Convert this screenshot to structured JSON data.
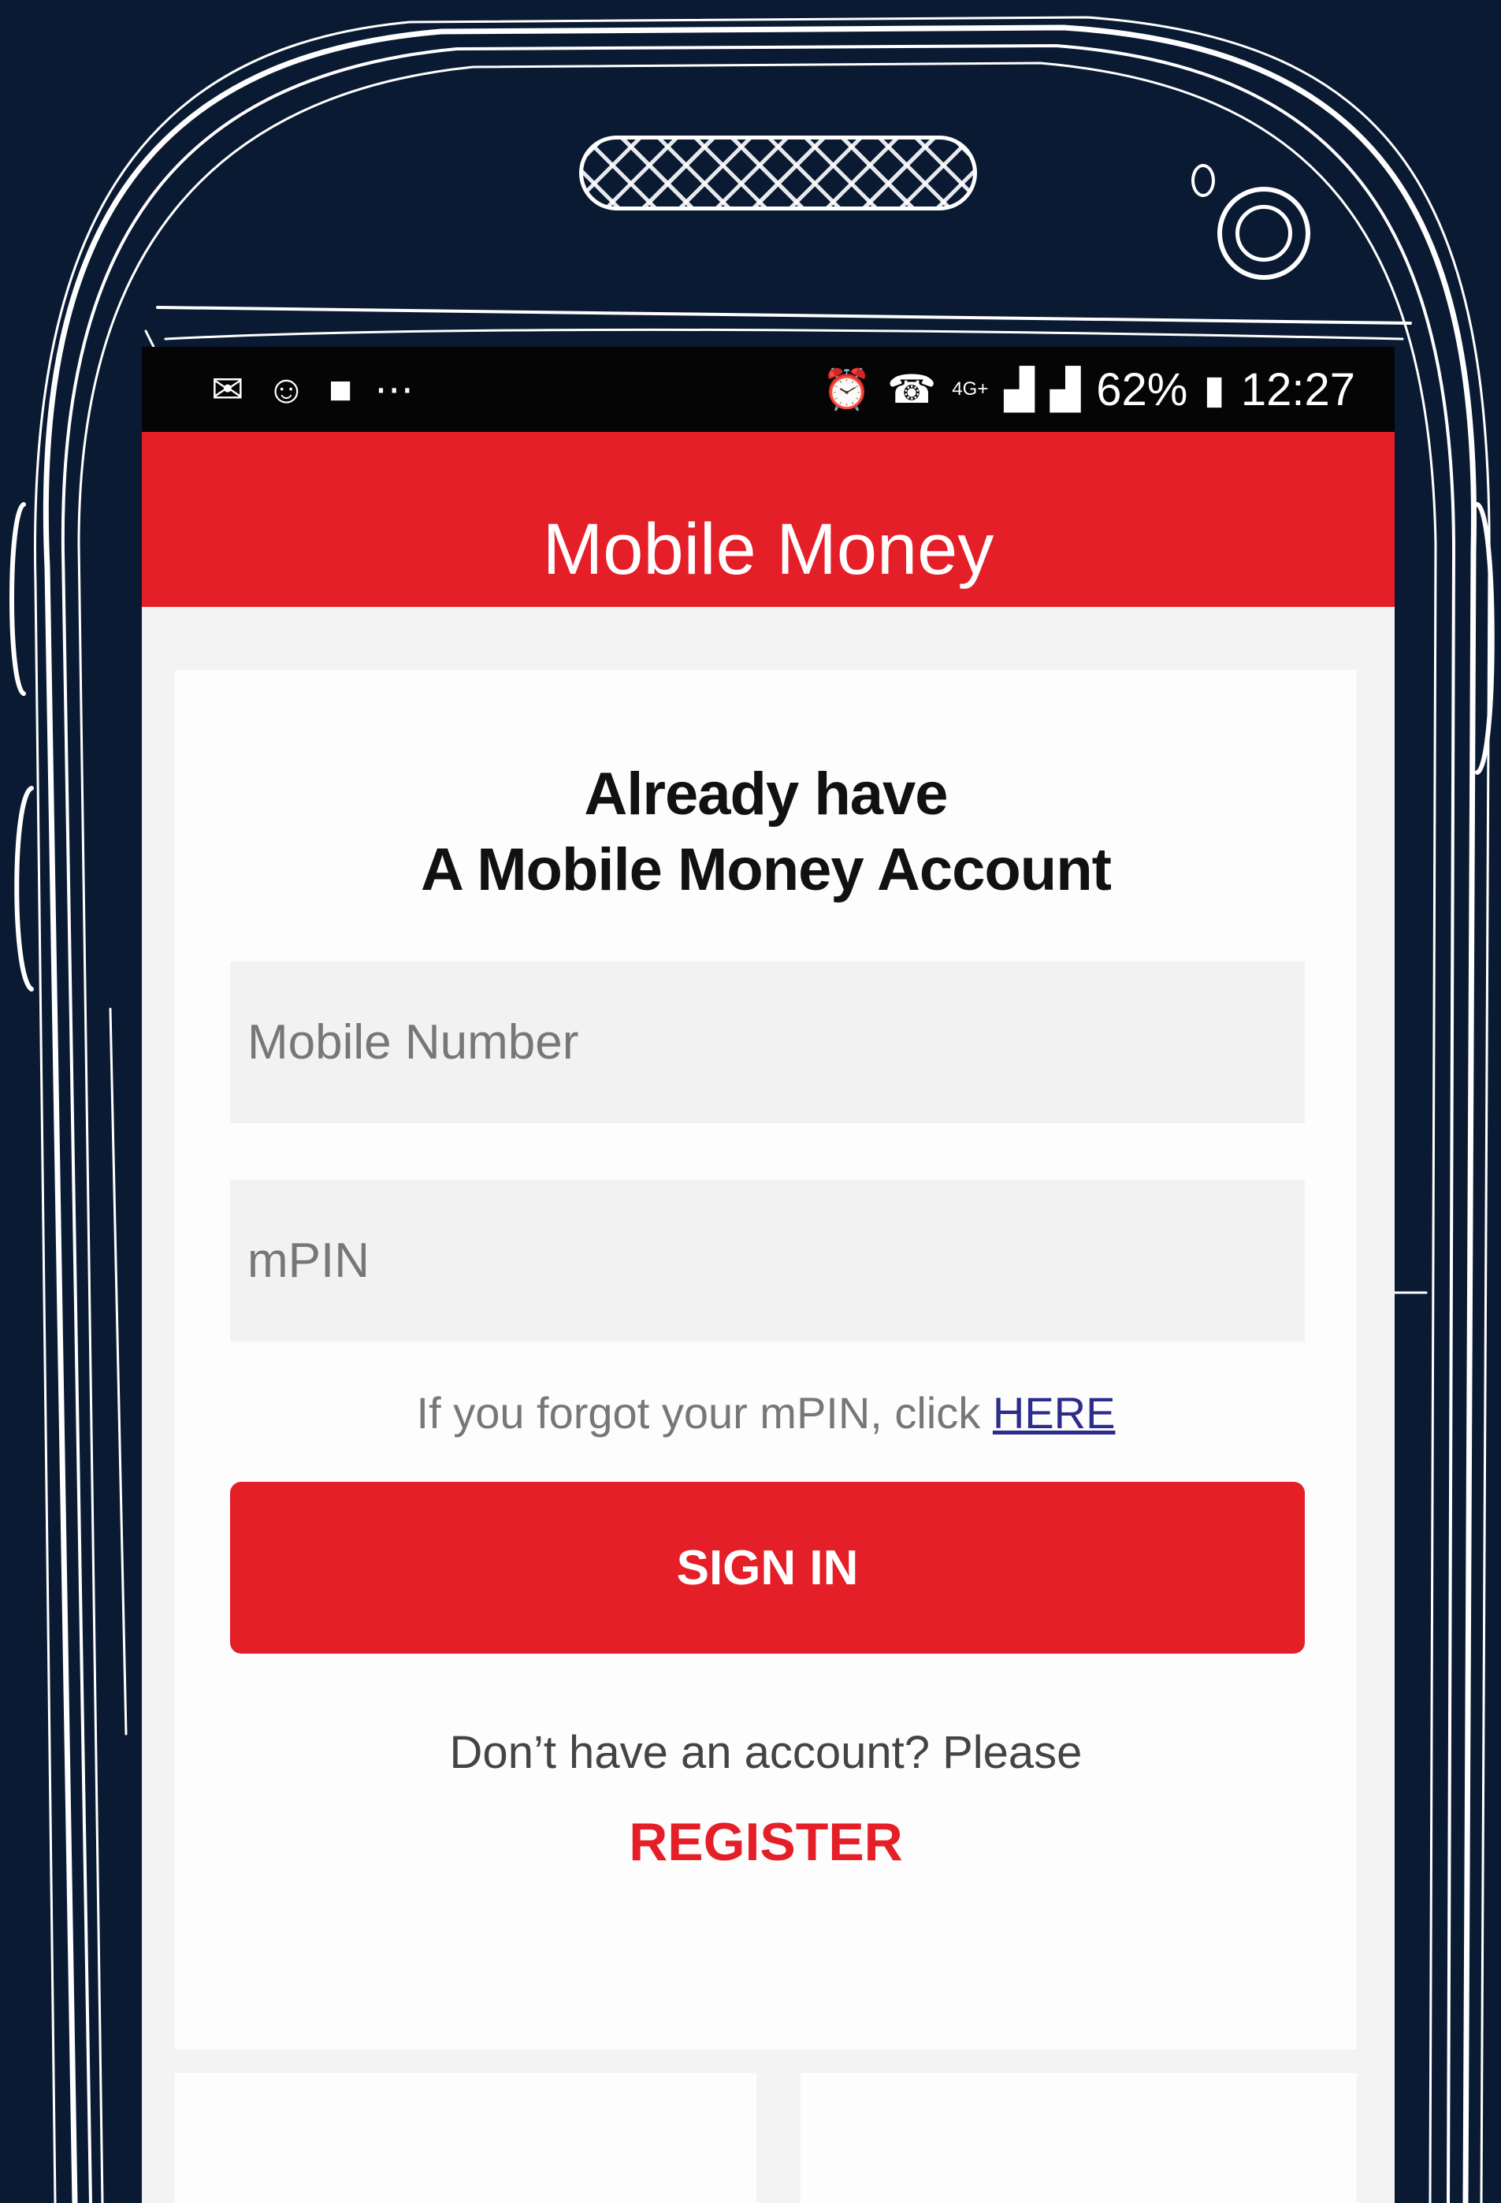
{
  "status_bar": {
    "left_icons": [
      "mail-icon",
      "account-icon",
      "chat-icon",
      "more-icon"
    ],
    "right_icons": [
      "alarm-icon",
      "phone-icon",
      "network-4g-icon",
      "signal-icon",
      "sim-signal-icon",
      "battery-icon"
    ],
    "network": "4G+",
    "battery": "62%",
    "time": "12:27"
  },
  "app": {
    "title": "Mobile Money",
    "accent_color": "#e41f28"
  },
  "login": {
    "heading_line1": "Already have",
    "heading_line2": "A Mobile Money Account",
    "mobile_placeholder": "Mobile Number",
    "mpin_placeholder": "mPIN",
    "forgot_text": "If you forgot your mPIN, click ",
    "forgot_link": "HERE",
    "signin_label": "SIGN IN",
    "no_account_text": "Don’t have an account? Please",
    "register_label": "REGISTER"
  }
}
